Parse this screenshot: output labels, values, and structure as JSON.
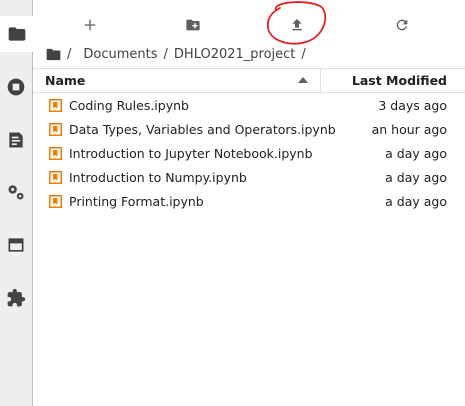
{
  "sidebar": {
    "tabs": [
      {
        "name": "file-browser"
      },
      {
        "name": "running-terminals-kernels"
      },
      {
        "name": "commands"
      },
      {
        "name": "property-inspector"
      },
      {
        "name": "open-tabs"
      },
      {
        "name": "extension-manager"
      }
    ]
  },
  "toolbar": {
    "new_launcher": "plus-icon",
    "new_folder": "new-folder-icon",
    "upload": "upload-icon",
    "refresh": "refresh-icon",
    "annotation_color": "#e02020"
  },
  "breadcrumb": {
    "separator": "/",
    "root": "/",
    "parts": [
      "Documents",
      "DHLO2021_project"
    ],
    "trailing": "/"
  },
  "file_list": {
    "columns": {
      "name": "Name",
      "modified": "Last Modified"
    },
    "sort": "ascending",
    "notebook_icon_color": "#f57c00",
    "rows": [
      {
        "name": "Coding Rules.ipynb",
        "modified": "3 days ago"
      },
      {
        "name": "Data Types, Variables and Operators.ipynb",
        "modified": "an hour ago"
      },
      {
        "name": "Introduction to Jupyter Notebook.ipynb",
        "modified": "a day ago"
      },
      {
        "name": "Introduction to Numpy.ipynb",
        "modified": "a day ago"
      },
      {
        "name": "Printing Format.ipynb",
        "modified": "a day ago"
      }
    ]
  }
}
